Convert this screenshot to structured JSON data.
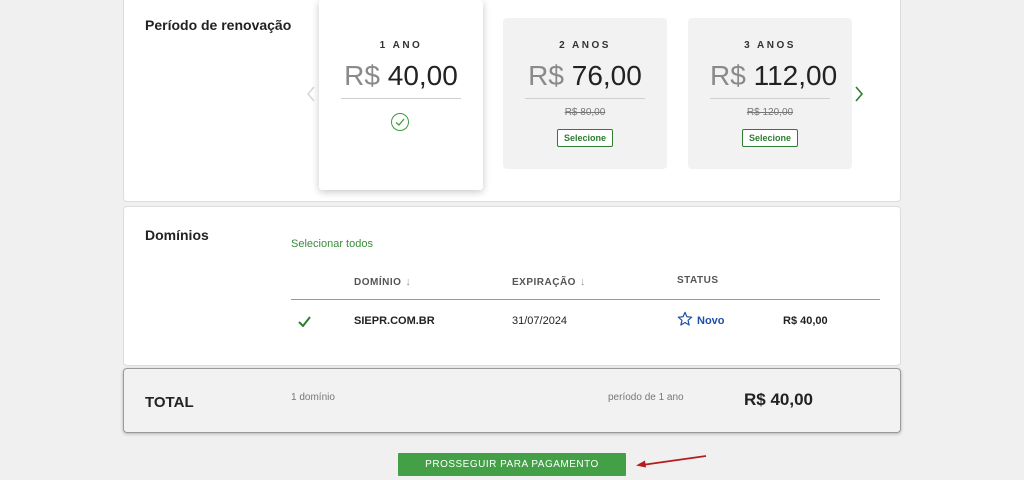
{
  "renewal": {
    "title": "Período de renovação",
    "plans": [
      {
        "period": "1 ANO",
        "currency": "R$",
        "amount": "40,00",
        "selected": true
      },
      {
        "period": "2 ANOS",
        "currency": "R$",
        "amount": "76,00",
        "old_price": "R$ 80,00",
        "action": "Selecione"
      },
      {
        "period": "3 ANOS",
        "currency": "R$",
        "amount": "112,00",
        "old_price": "R$ 120,00",
        "action": "Selecione"
      }
    ]
  },
  "domains": {
    "title": "Domínios",
    "select_all": "Selecionar todos",
    "columns": {
      "domain": "DOMÍNIO",
      "expiration": "EXPIRAÇÃO",
      "status": "STATUS"
    },
    "rows": [
      {
        "domain": "SIEPR.COM.BR",
        "expiration": "31/07/2024",
        "status": "Novo",
        "price": "R$ 40,00"
      }
    ]
  },
  "total": {
    "label": "TOTAL",
    "count": "1 domínio",
    "period": "período de 1 ano",
    "amount": "R$ 40,00"
  },
  "proceed_label": "PROSSEGUIR PARA PAGAMENTO",
  "colors": {
    "accent": "#43a047",
    "status_blue": "#1e4fa8",
    "arrow": "#b71c1c"
  }
}
